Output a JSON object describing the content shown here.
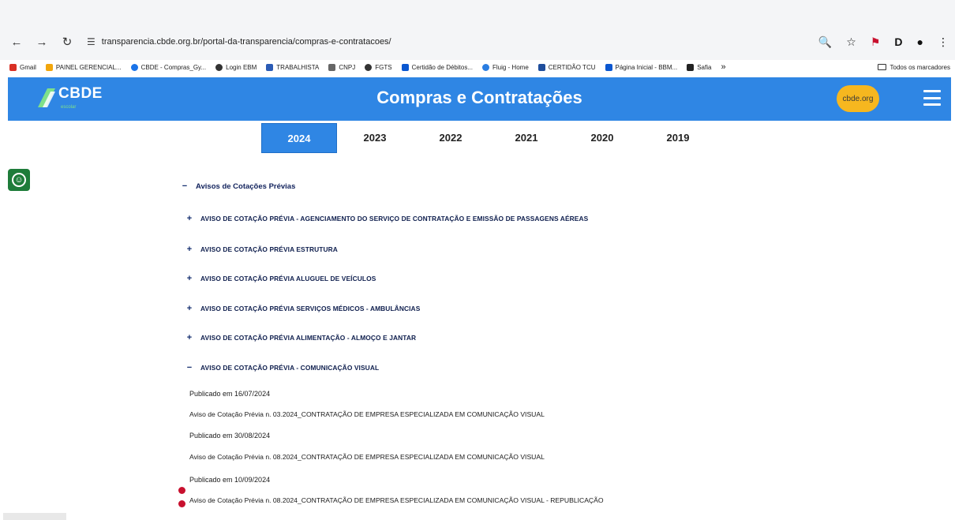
{
  "browser": {
    "url": "transparencia.cbde.org.br/portal-da-transparencia/compras-e-contratacoes/",
    "bookmarks": [
      {
        "label": "Gmail",
        "color": "#d93025"
      },
      {
        "label": "PAINEL GERENCIAL...",
        "color": "#f2a60c"
      },
      {
        "label": "CBDE - Compras_Gy...",
        "color": "#1a73e8"
      },
      {
        "label": "Login EBM",
        "color": "#333333"
      },
      {
        "label": "TRABALHISTA",
        "color": "#2b5bb5"
      },
      {
        "label": "CNPJ",
        "color": "#666666"
      },
      {
        "label": "FGTS",
        "color": "#333333"
      },
      {
        "label": "Certidão de Débitos...",
        "color": "#0b57d0"
      },
      {
        "label": "Fluig - Home",
        "color": "#2a7de1"
      },
      {
        "label": "CERTIDÃO TCU",
        "color": "#1f4e9c"
      },
      {
        "label": "Página Inicial - BBM...",
        "color": "#0b57d0"
      },
      {
        "label": "Safia",
        "color": "#222222"
      }
    ],
    "bookmarks_overflow": "»",
    "all_bookmarks": "Todos os marcadores"
  },
  "header": {
    "logo": "CBDE",
    "logo_sub": "escolar",
    "title": "Compras e Contratações",
    "site_button": "cbde.org"
  },
  "years": [
    "2024",
    "2023",
    "2022",
    "2021",
    "2020",
    "2019"
  ],
  "active_year": "2024",
  "category": {
    "sign": "−",
    "title": "Avisos de Cotações Prévias"
  },
  "items": [
    {
      "sign": "+",
      "label": "AVISO DE COTAÇÃO PRÉVIA - AGENCIAMENTO DO SERVIÇO DE CONTRATAÇÃO E EMISSÃO DE PASSAGENS AÉREAS"
    },
    {
      "sign": "+",
      "label": "AVISO DE COTAÇÃO PRÉVIA ESTRUTURA"
    },
    {
      "sign": "+",
      "label": "AVISO DE COTAÇÃO PRÉVIA ALUGUEL DE VEÍCULOS"
    },
    {
      "sign": "+",
      "label": "AVISO DE COTAÇÃO PRÉVIA SERVIÇOS MÉDICOS - AMBULÂNCIAS"
    },
    {
      "sign": "+",
      "label": "AVISO DE COTAÇÃO PRÉVIA ALIMENTAÇÃO - ALMOÇO E JANTAR"
    },
    {
      "sign": "−",
      "label": "AVISO DE COTAÇÃO PRÉVIA - COMUNICAÇÃO VISUAL"
    }
  ],
  "publications": [
    {
      "date": "Publicado em 16/07/2024",
      "doc": "Aviso de Cotação Prévia n. 03.2024_CONTRATAÇÃO DE EMPRESA ESPECIALIZADA EM COMUNICAÇÃO VISUAL"
    },
    {
      "date": "Publicado em 30/08/2024",
      "doc": "Aviso de Cotação Prévia n. 08.2024_CONTRATAÇÃO DE EMPRESA ESPECIALIZADA EM COMUNICAÇÃO VISUAL"
    },
    {
      "date": "Publicado em 10/09/2024",
      "doc": "Aviso de Cotação Prévia n. 08.2024_CONTRATAÇÃO DE EMPRESA ESPECIALIZADA EM COMUNICAÇÃO VISUAL - REPUBLICAÇÃO"
    }
  ]
}
